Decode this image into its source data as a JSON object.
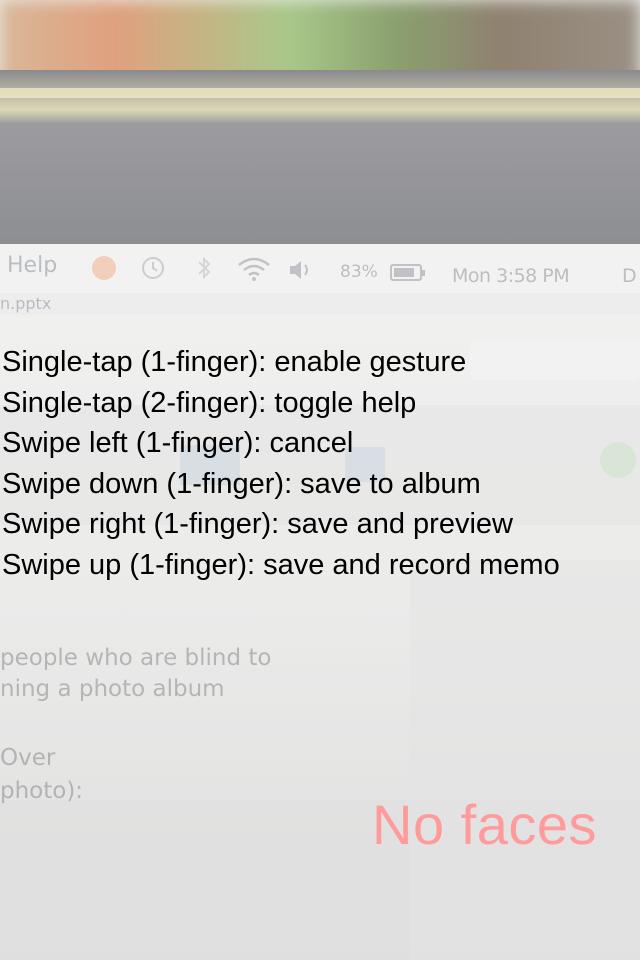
{
  "camera_background": {
    "menubar": {
      "help_label": "Help",
      "battery_percent": "83%",
      "clock": "Mon 3:58 PM",
      "cut_off_edge": "D",
      "icons": [
        "app-icon",
        "time-machine-icon",
        "bluetooth-icon",
        "wifi-icon",
        "volume-icon",
        "battery-icon"
      ]
    },
    "window_filename": "n.pptx",
    "slide_text_lines": [
      "people who are blind to",
      "ning a photo album",
      "Over",
      "photo):"
    ]
  },
  "help_overlay": {
    "lines": [
      "Single-tap (1-finger): enable gesture",
      "Single-tap (2-finger): toggle help",
      "Swipe left (1-finger): cancel",
      "Swipe down (1-finger): save to album",
      "Swipe right (1-finger): save and preview",
      "Swipe up (1-finger): save and record memo"
    ]
  },
  "status_text": "No faces",
  "colors": {
    "help_text": "#000000",
    "status_text": "#ff9b9b"
  }
}
